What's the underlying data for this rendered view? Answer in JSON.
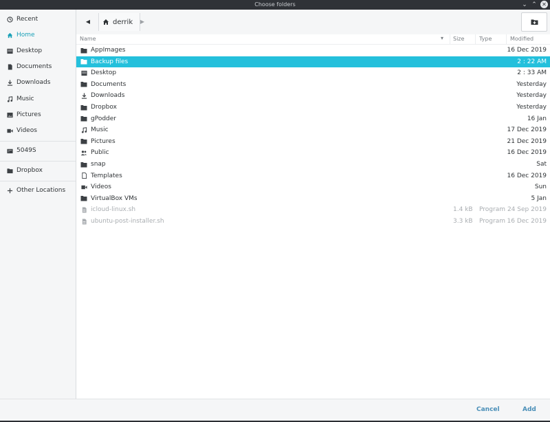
{
  "window": {
    "title": "Choose folders"
  },
  "colors": {
    "accent": "#24c0dc",
    "sidebar_active": "#1ba1b8",
    "button_text": "#4a8fb8"
  },
  "sidebar": {
    "items": [
      {
        "label": "Recent",
        "icon": "clock-icon"
      },
      {
        "label": "Home",
        "icon": "home-icon",
        "active": true
      },
      {
        "label": "Desktop",
        "icon": "desktop-icon"
      },
      {
        "label": "Documents",
        "icon": "document-icon"
      },
      {
        "label": "Downloads",
        "icon": "download-icon"
      },
      {
        "label": "Music",
        "icon": "music-icon"
      },
      {
        "label": "Pictures",
        "icon": "picture-icon"
      },
      {
        "label": "Videos",
        "icon": "video-icon"
      },
      {
        "label": "5049S",
        "icon": "drive-icon"
      },
      {
        "label": "Dropbox",
        "icon": "folder-icon"
      },
      {
        "label": "Other Locations",
        "icon": "plus-icon"
      }
    ]
  },
  "toolbar": {
    "path": "derrik",
    "path_icon": "home-icon"
  },
  "columns": {
    "name": "Name",
    "size": "Size",
    "type": "Type",
    "modified": "Modified"
  },
  "files": [
    {
      "name": "AppImages",
      "size": "",
      "type": "",
      "modified": "16 Dec 2019",
      "icon": "folder-icon"
    },
    {
      "name": "Backup files",
      "size": "",
      "type": "",
      "modified": "2 : 22 AM",
      "icon": "folder-icon",
      "selected": true
    },
    {
      "name": "Desktop",
      "size": "",
      "type": "",
      "modified": "2 : 33 AM",
      "icon": "desktop-icon"
    },
    {
      "name": "Documents",
      "size": "",
      "type": "",
      "modified": "Yesterday",
      "icon": "folder-icon"
    },
    {
      "name": "Downloads",
      "size": "",
      "type": "",
      "modified": "Yesterday",
      "icon": "download-icon"
    },
    {
      "name": "Dropbox",
      "size": "",
      "type": "",
      "modified": "Yesterday",
      "icon": "folder-icon"
    },
    {
      "name": "gPodder",
      "size": "",
      "type": "",
      "modified": "16 Jan",
      "icon": "folder-icon"
    },
    {
      "name": "Music",
      "size": "",
      "type": "",
      "modified": "17 Dec 2019",
      "icon": "music-icon"
    },
    {
      "name": "Pictures",
      "size": "",
      "type": "",
      "modified": "21 Dec 2019",
      "icon": "folder-icon"
    },
    {
      "name": "Public",
      "size": "",
      "type": "",
      "modified": "16 Dec 2019",
      "icon": "users-icon"
    },
    {
      "name": "snap",
      "size": "",
      "type": "",
      "modified": "Sat",
      "icon": "folder-icon"
    },
    {
      "name": "Templates",
      "size": "",
      "type": "",
      "modified": "16 Dec 2019",
      "icon": "template-icon"
    },
    {
      "name": "Videos",
      "size": "",
      "type": "",
      "modified": "Sun",
      "icon": "video-icon"
    },
    {
      "name": "VirtualBox VMs",
      "size": "",
      "type": "",
      "modified": "5 Jan",
      "icon": "folder-icon"
    },
    {
      "name": "icloud-linux.sh",
      "size": "1.4 kB",
      "type": "Program",
      "modified": "24 Sep 2019",
      "icon": "file-icon",
      "dim": true
    },
    {
      "name": "ubuntu-post-installer.sh",
      "size": "3.3 kB",
      "type": "Program",
      "modified": "16 Dec 2019",
      "icon": "file-icon",
      "dim": true
    }
  ],
  "buttons": {
    "cancel": "Cancel",
    "add": "Add"
  }
}
